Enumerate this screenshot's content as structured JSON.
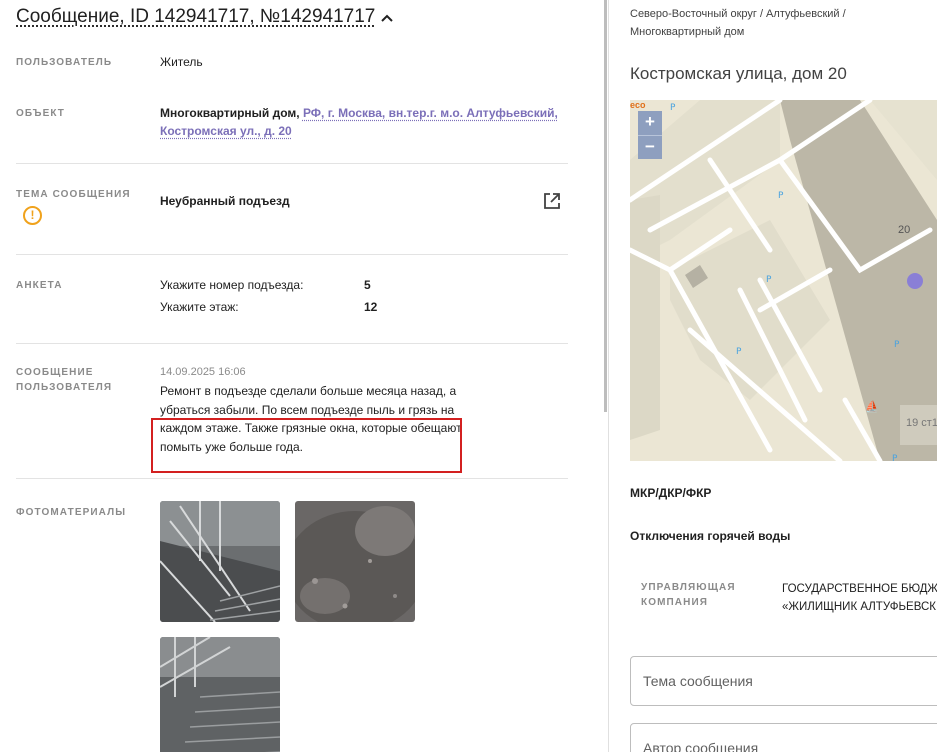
{
  "message": {
    "title": "Сообщение, ID 142941717, №142941717",
    "collapse_icon": "chevron-up-icon"
  },
  "rows": {
    "user": {
      "label": "ПОЛЬЗОВАТЕЛЬ",
      "value": "Житель"
    },
    "object": {
      "label": "ОБЪЕКТ",
      "type": "Многоквартирный дом,",
      "address_line1": "РФ, г. Москва, вн.тер.г. м.о. Алтуфьевский,",
      "address_line2": "Костромская ул., д. 20"
    },
    "topic": {
      "label": "ТЕМА СООБЩЕНИЯ",
      "value": "Неубранный подъезд",
      "warning_icon": "!"
    },
    "survey": {
      "label": "АНКЕТА",
      "items": [
        {
          "question": "Укажите номер подъезда:",
          "answer": "5"
        },
        {
          "question": "Укажите этаж:",
          "answer": "12"
        }
      ]
    },
    "user_message": {
      "label_line1": "СООБЩЕНИЕ",
      "label_line2": "ПОЛЬЗОВАТЕЛЯ",
      "date": "14.09.2025 16:06",
      "text": "Ремонт в подъезде сделали больше месяца назад, а убраться забыли. По всем подъезде пыль и грязь на каждом этаже. Также грязные окна, которые обещают помыть уже больше года."
    },
    "photos": {
      "label": "ФОТОМАТЕРИАЛЫ",
      "count": 3
    }
  },
  "side": {
    "breadcrumb_line1": "Северо-Восточный округ / Алтуфьевский /",
    "breadcrumb_line2": "Многоквартирный дом",
    "address": "Костромская улица, дом 20",
    "map": {
      "zoom_in": "+",
      "zoom_out": "−",
      "logo": "eco",
      "house_20": "20",
      "house_19": "19 ст1"
    },
    "mkr_label": "МКР/ДКР/ФКР",
    "hot_water_label": "Отключения горячей воды",
    "uk": {
      "label_line1": "УПРАВЛЯЮЩАЯ",
      "label_line2": "КОМПАНИЯ",
      "value_line1": "ГОСУДАРСТВЕННОЕ БЮДЖ",
      "value_line2": "«ЖИЛИЩНИК АЛТУФЬЕВСК"
    },
    "fields": {
      "topic_placeholder": "Тема сообщения",
      "author_placeholder": "Автор сообщения"
    }
  },
  "colors": {
    "accent_link": "#7b6fb8",
    "warning": "#f0a21c",
    "highlight": "#d32020",
    "map_marker": "#8a7fd6"
  }
}
